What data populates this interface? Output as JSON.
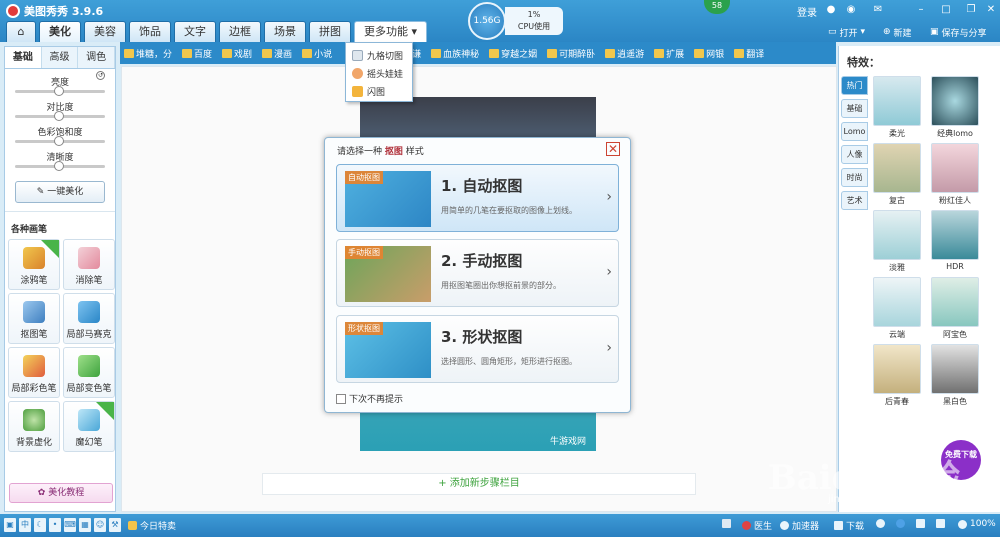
{
  "app": {
    "title": "美图秀秀 3.9.6"
  },
  "cpu": {
    "memory": "1.56G",
    "percent": "1%",
    "label": "CPU使用"
  },
  "notif": "58",
  "header_right": {
    "login": "登录",
    "open": "打开",
    "new": "新建",
    "save": "保存与分享"
  },
  "nav_tabs": [
    "美化",
    "美容",
    "饰品",
    "文字",
    "边框",
    "场景",
    "拼图",
    "更多功能"
  ],
  "bookmarks": [
    "堆糖，分",
    "百度",
    "戏剧",
    "漫画",
    "小说",
    "",
    "谦",
    "血族神秘",
    "穿越之姻",
    "可期醉卧",
    "逍遥游",
    "扩展",
    "网银",
    "翻译"
  ],
  "dropdown": [
    "九格切图",
    "摇头娃娃",
    "闪图"
  ],
  "left_panel": {
    "tabs": [
      "基础",
      "高级",
      "调色"
    ],
    "sliders": [
      {
        "label": "亮度",
        "value": 0.5
      },
      {
        "label": "对比度",
        "value": 0.5
      },
      {
        "label": "色彩饱和度",
        "value": 0.5
      },
      {
        "label": "清晰度",
        "value": 0.5
      }
    ],
    "one_click": "一键美化",
    "brushes_title": "各种画笔",
    "tools": [
      "涂鸦笔",
      "消除笔",
      "抠图笔",
      "局部马赛克",
      "局部彩色笔",
      "局部变色笔",
      "背景虚化",
      "魔幻笔"
    ],
    "tool_badges": {
      "doodle": "升级",
      "magic": "new"
    },
    "tutorial": "美化教程"
  },
  "dialog": {
    "title_prefix": "请选择一种",
    "title_highlight": "抠图",
    "title_suffix": "样式",
    "options": [
      {
        "tag": "自动抠图",
        "title": "1. 自动抠图",
        "desc": "用简单的几笔在要抠取的图像上划线。"
      },
      {
        "tag": "手动抠图",
        "title": "2. 手动抠图",
        "desc": "用抠图笔圈出你想抠前景的部分。"
      },
      {
        "tag": "形状抠图",
        "title": "3. 形状抠图",
        "desc": "选择圆形、圆角矩形，矩形进行抠图。"
      }
    ],
    "checkbox": "下次不再提示"
  },
  "canvas": {
    "add_step": "+ 添加新步骤栏目",
    "photo_watermark": "牛游戏网"
  },
  "right_panel": {
    "title": "特效：",
    "side_tabs": [
      "热门",
      "基础",
      "Lomo",
      "人像",
      "时尚",
      "艺术"
    ],
    "effects": [
      "柔光",
      "经典lomo",
      "复古",
      "粉红佳人",
      "淡雅",
      "HDR",
      "云端",
      "阿宝色",
      "后青春",
      "黑白色"
    ],
    "free_download": "免费下载"
  },
  "statusbar": {
    "today": "今日特卖",
    "doctor": "医生",
    "accelerate": "加速器",
    "download": "下载",
    "zoom": "100%"
  },
  "watermark": {
    "brand": "Baidu 经验",
    "url": "jingyan.baidu.com"
  },
  "colors": {
    "accent": "#2c8ac9",
    "title_bar": "#3f9fd8",
    "highlight": "#b0303a",
    "add_step": "#3ea33e"
  }
}
